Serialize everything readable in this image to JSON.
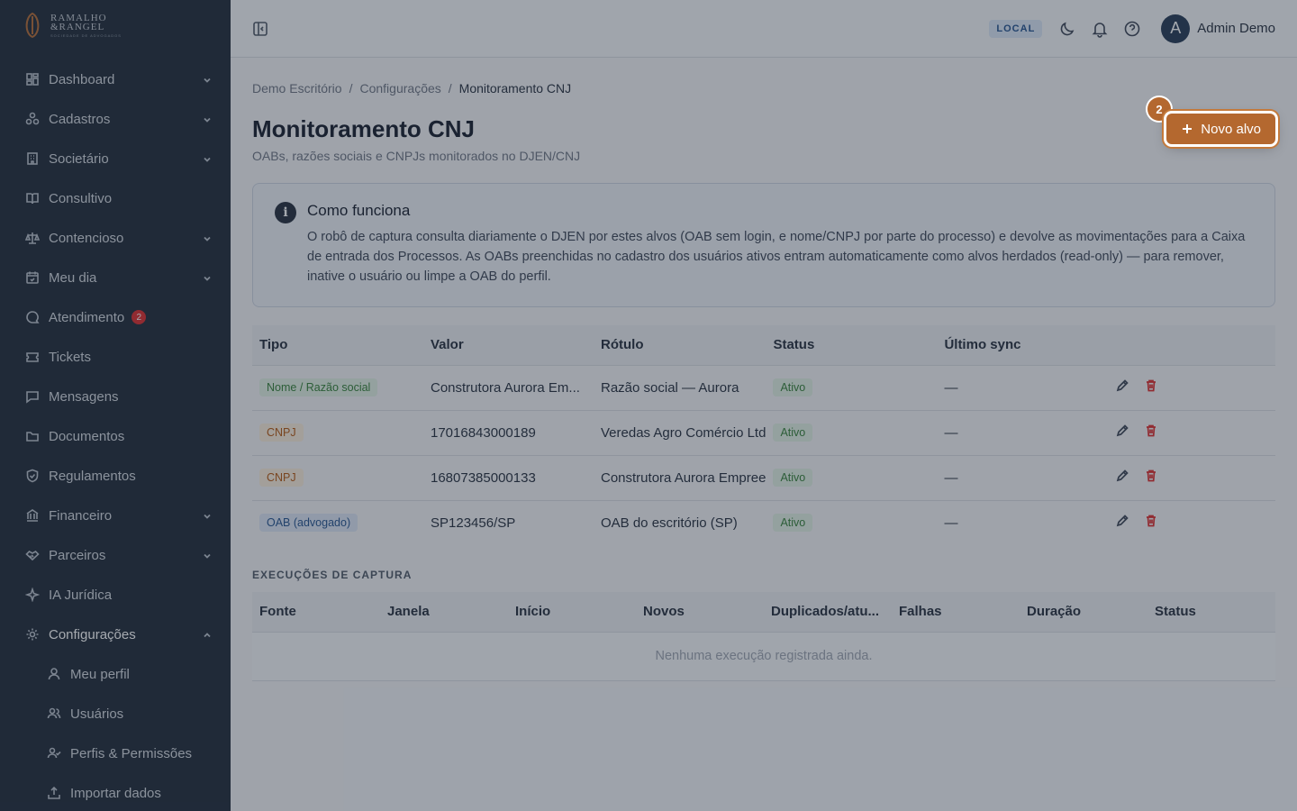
{
  "brand": {
    "name_line1": "RAMALHO",
    "name_line2": "&RANGEL",
    "tagline": "SOCIEDADE DE ADVOGADOS"
  },
  "sidebar": {
    "items": [
      {
        "label": "Dashboard",
        "icon": "dashboard-icon",
        "chevron": "down"
      },
      {
        "label": "Cadastros",
        "icon": "cadastros-icon",
        "chevron": "down"
      },
      {
        "label": "Societário",
        "icon": "building-icon",
        "chevron": "down"
      },
      {
        "label": "Consultivo",
        "icon": "book-icon",
        "chevron": ""
      },
      {
        "label": "Contencioso",
        "icon": "scales-icon",
        "chevron": "down"
      },
      {
        "label": "Meu dia",
        "icon": "calendar-icon",
        "chevron": "down"
      },
      {
        "label": "Atendimento",
        "icon": "chat-icon",
        "chevron": "",
        "badge": "2"
      },
      {
        "label": "Tickets",
        "icon": "ticket-icon",
        "chevron": ""
      },
      {
        "label": "Mensagens",
        "icon": "message-icon",
        "chevron": ""
      },
      {
        "label": "Documentos",
        "icon": "folder-icon",
        "chevron": ""
      },
      {
        "label": "Regulamentos",
        "icon": "shield-icon",
        "chevron": ""
      },
      {
        "label": "Financeiro",
        "icon": "bank-icon",
        "chevron": "down"
      },
      {
        "label": "Parceiros",
        "icon": "handshake-icon",
        "chevron": "down"
      },
      {
        "label": "IA Jurídica",
        "icon": "sparkle-icon",
        "chevron": ""
      },
      {
        "label": "Configurações",
        "icon": "gear-icon",
        "chevron": "up"
      }
    ],
    "subitems": [
      {
        "label": "Meu perfil",
        "icon": "user-icon"
      },
      {
        "label": "Usuários",
        "icon": "users-icon"
      },
      {
        "label": "Perfis & Permissões",
        "icon": "user-check-icon"
      },
      {
        "label": "Importar dados",
        "icon": "upload-icon"
      }
    ]
  },
  "topbar": {
    "env": "LOCAL",
    "avatar_initial": "A",
    "username": "Admin Demo"
  },
  "breadcrumb": {
    "items": [
      "Demo Escritório",
      "Configurações"
    ],
    "current": "Monitoramento CNJ",
    "separator": "/"
  },
  "page": {
    "title": "Monitoramento CNJ",
    "subtitle": "OABs, razões sociais e CNPJs monitorados no DJEN/CNJ"
  },
  "new_button": {
    "label": "Novo alvo",
    "step": "2",
    "accent": "#b4682f"
  },
  "info": {
    "title": "Como funciona",
    "body": "O robô de captura consulta diariamente o DJEN por estes alvos (OAB sem login, e nome/CNPJ por parte do processo) e devolve as movimentações para a Caixa de entrada dos Processos. As OABs preenchidas no cadastro dos usuários ativos entram automaticamente como alvos herdados (read-only) — para remover, inative o usuário ou limpe a OAB do perfil."
  },
  "targets": {
    "headers": [
      "Tipo",
      "Valor",
      "Rótulo",
      "Status",
      "Último sync",
      ""
    ],
    "rows": [
      {
        "tipo": "Nome / Razão social",
        "tipo_color": "green",
        "valor": "Construtora Aurora Em...",
        "rotulo": "Razão social — Aurora",
        "status": "Ativo",
        "sync": "—"
      },
      {
        "tipo": "CNPJ",
        "tipo_color": "amber",
        "valor": "17016843000189",
        "rotulo": "Veredas Agro Comércio Ltd",
        "status": "Ativo",
        "sync": "—"
      },
      {
        "tipo": "CNPJ",
        "tipo_color": "amber",
        "valor": "16807385000133",
        "rotulo": "Construtora Aurora Empree",
        "status": "Ativo",
        "sync": "—"
      },
      {
        "tipo": "OAB (advogado)",
        "tipo_color": "blue",
        "valor": "SP123456/SP",
        "rotulo": "OAB do escritório (SP)",
        "status": "Ativo",
        "sync": "—"
      }
    ]
  },
  "runs": {
    "section_label": "EXECUÇÕES DE CAPTURA",
    "headers": [
      "Fonte",
      "Janela",
      "Início",
      "Novos",
      "Duplicados/atu...",
      "Falhas",
      "Duração",
      "Status"
    ],
    "empty": "Nenhuma execução registrada ainda."
  }
}
